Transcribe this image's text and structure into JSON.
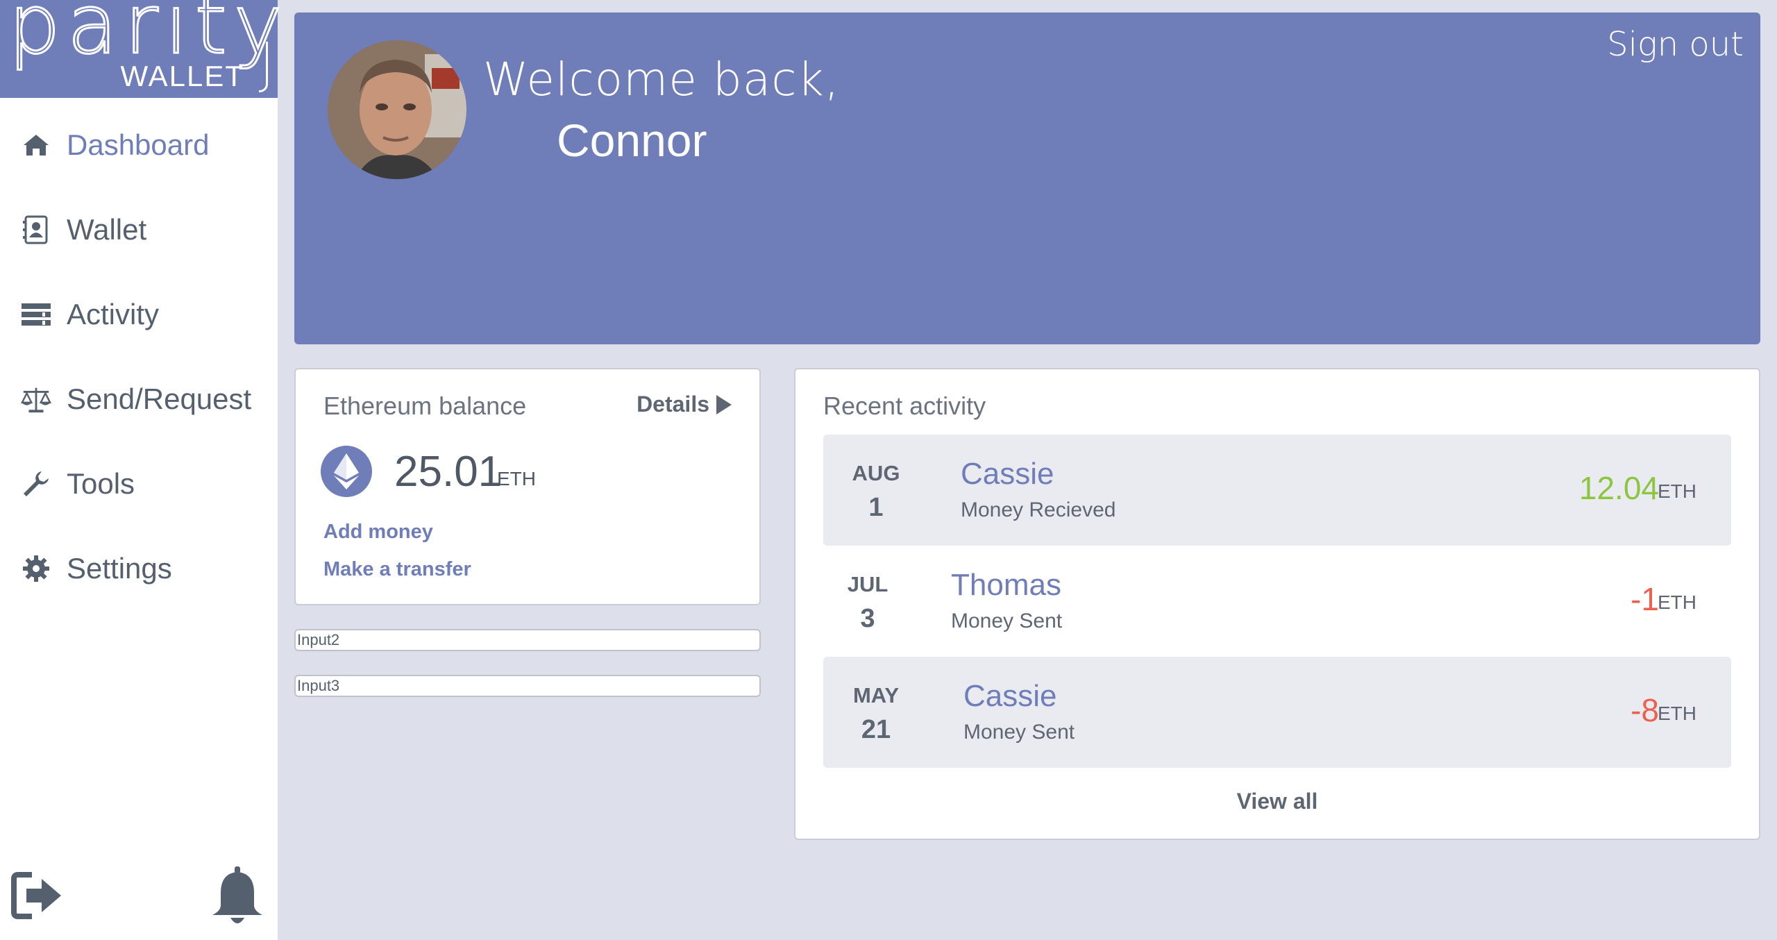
{
  "logo": {
    "word": "parity",
    "sub": "WALLET"
  },
  "nav": [
    {
      "label": "Dashboard",
      "icon": "home-icon",
      "active": true
    },
    {
      "label": "Wallet",
      "icon": "contact-book-icon",
      "active": false
    },
    {
      "label": "Activity",
      "icon": "server-icon",
      "active": false
    },
    {
      "label": "Send/Request",
      "icon": "balance-scale-icon",
      "active": false
    },
    {
      "label": "Tools",
      "icon": "wrench-icon",
      "active": false
    },
    {
      "label": "Settings",
      "icon": "gear-icon",
      "active": false
    }
  ],
  "header": {
    "welcome": "Welcome back,",
    "username": "Connor",
    "sign_out": "Sign out"
  },
  "balance": {
    "title": "Ethereum balance",
    "details_label": "Details",
    "amount": "25.01",
    "unit": "ETH",
    "add_money": "Add money",
    "make_transfer": "Make a transfer"
  },
  "inputs": {
    "input2": "Input2",
    "input3": "Input3"
  },
  "activity": {
    "title": "Recent activity",
    "view_all": "View all",
    "rows": [
      {
        "month": "AUG",
        "day": "1",
        "name": "Cassie",
        "type": "Money Recieved",
        "amount": "12.04",
        "unit": "ETH",
        "direction": "in"
      },
      {
        "month": "JUL",
        "day": "3",
        "name": "Thomas",
        "type": "Money Sent",
        "amount": "-1",
        "unit": "ETH",
        "direction": "out"
      },
      {
        "month": "MAY",
        "day": "21",
        "name": "Cassie",
        "type": "Money Sent",
        "amount": "-8",
        "unit": "ETH",
        "direction": "out"
      }
    ]
  },
  "colors": {
    "accent": "#6f7db8",
    "positive": "#8cc63f",
    "negative": "#ef5f4d",
    "background": "#dde0ea"
  }
}
